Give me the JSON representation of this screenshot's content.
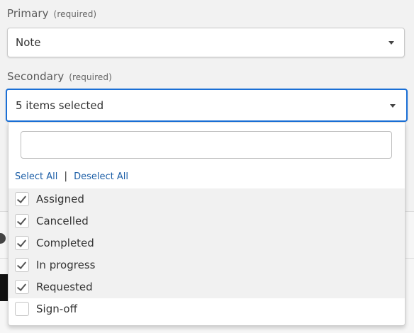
{
  "primary": {
    "label": "Primary",
    "required_note": "(required)",
    "value": "Note",
    "caret_icon": "caret-down"
  },
  "secondary": {
    "label": "Secondary",
    "required_note": "(required)",
    "value": "5 items selected",
    "caret_icon": "caret-down",
    "focus_color": "#1a6fd6"
  },
  "dropdown": {
    "search": {
      "value": "",
      "placeholder": ""
    },
    "select_all_label": "Select All",
    "separator": "|",
    "deselect_all_label": "Deselect All",
    "link_color": "#1d5fa7",
    "options": [
      {
        "label": "Assigned",
        "checked": true
      },
      {
        "label": "Cancelled",
        "checked": true
      },
      {
        "label": "Completed",
        "checked": true
      },
      {
        "label": "In progress",
        "checked": true
      },
      {
        "label": "Requested",
        "checked": true
      },
      {
        "label": "Sign-off",
        "checked": false
      }
    ]
  }
}
